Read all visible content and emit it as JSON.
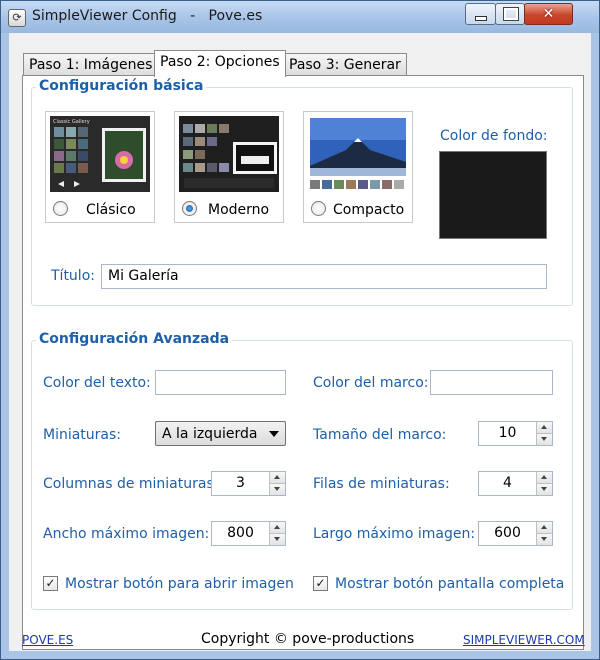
{
  "window": {
    "title": "SimpleViewer Config   -   Pove.es",
    "close_glyph": "✕"
  },
  "tabs": [
    {
      "label": "Paso 1: Imágenes",
      "active": false
    },
    {
      "label": "Paso 2: Opciones",
      "active": true
    },
    {
      "label": "Paso 3: Generar",
      "active": false
    }
  ],
  "basic": {
    "title": "Configuración básica",
    "styles": [
      {
        "label": "Clásico",
        "selected": false,
        "caption": "Classic Gallery"
      },
      {
        "label": "Moderno",
        "selected": true
      },
      {
        "label": "Compacto",
        "selected": false
      }
    ],
    "bg_color_label": "Color de fondo:",
    "bg_color": "#1a1a1a",
    "title_label": "Título:",
    "title_value": "Mi Galería"
  },
  "advanced": {
    "title": "Configuración Avanzada",
    "text_color_label": "Color del texto:",
    "text_color_value": "",
    "frame_color_label": "Color del marco:",
    "frame_color_value": "",
    "thumbs_label": "Miniaturas:",
    "thumbs_value": "A la izquierda",
    "frame_size_label": "Tamaño del marco:",
    "frame_size_value": "10",
    "thumb_cols_label": "Columnas de miniaturas:",
    "thumb_cols_value": "3",
    "thumb_rows_label": "Filas de miniaturas:",
    "thumb_rows_value": "4",
    "max_width_label": "Ancho máximo imagen:",
    "max_width_value": "800",
    "max_height_label": "Largo máximo imagen:",
    "max_height_value": "600",
    "open_btn_label": "Mostrar botón para abrir imagen",
    "open_btn_checked": true,
    "fullscreen_label": "Mostrar botón pantalla completa",
    "fullscreen_checked": true,
    "check_glyph": "✓"
  },
  "footer": {
    "left_link": "POVE.ES",
    "copyright": "Copyright © pove-productions",
    "right_link": "SIMPLEVIEWER.COM"
  },
  "colors": {
    "label_blue": "#1e5fa8",
    "link_blue": "#1a3ab0"
  }
}
